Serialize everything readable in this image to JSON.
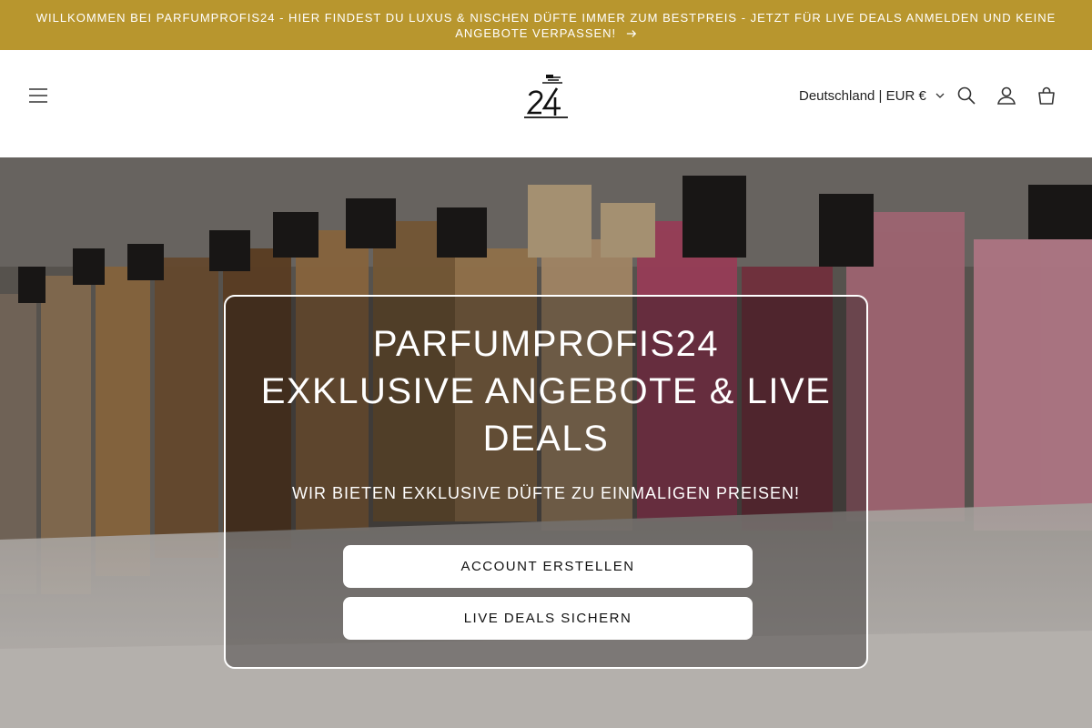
{
  "announcement": {
    "text": "WILLKOMMEN BEI PARFUMPROFIS24 - HIER FINDEST DU LUXUS & NISCHEN DÜFTE IMMER ZUM BESTPREIS - JETZT FÜR LIVE DEALS ANMELDEN UND KEINE ANGEBOTE VERPASSEN!",
    "background": "#b8962e"
  },
  "header": {
    "logo_icon": "parfumprofis24-logo",
    "menu_icon": "hamburger-icon",
    "country_selector": "Deutschland | EUR €",
    "search_icon": "search-icon",
    "account_icon": "account-icon",
    "cart_icon": "cart-icon"
  },
  "hero": {
    "title_lines": [
      "PARFUMPROFIS24",
      "EXKLUSIVE ANGEBOTE & LIVE",
      "DEALS"
    ],
    "subtitle": "WIR BIETEN EXKLUSIVE DÜFTE ZU EINMALIGEN PREISEN!",
    "buttons": [
      {
        "label": "ACCOUNT ERSTELLEN"
      },
      {
        "label": "LIVE DEALS SICHERN"
      }
    ]
  }
}
